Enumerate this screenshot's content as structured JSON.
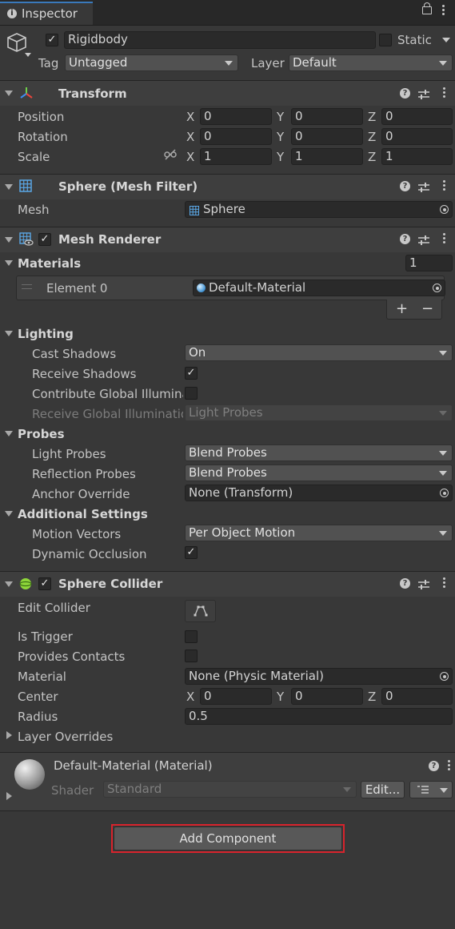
{
  "window": {
    "tab_title": "Inspector"
  },
  "object": {
    "name": "Rigidbody",
    "static_label": "Static",
    "tag_label": "Tag",
    "tag_value": "Untagged",
    "layer_label": "Layer",
    "layer_value": "Default"
  },
  "transform": {
    "title": "Transform",
    "rows": [
      {
        "label": "Position",
        "x": "0",
        "y": "0",
        "z": "0"
      },
      {
        "label": "Rotation",
        "x": "0",
        "y": "0",
        "z": "0"
      },
      {
        "label": "Scale",
        "x": "1",
        "y": "1",
        "z": "1"
      }
    ],
    "axis": {
      "x": "X",
      "y": "Y",
      "z": "Z"
    }
  },
  "mesh_filter": {
    "title": "Sphere (Mesh Filter)",
    "mesh_label": "Mesh",
    "mesh_value": "Sphere"
  },
  "mesh_renderer": {
    "title": "Mesh Renderer",
    "materials_label": "Materials",
    "materials_count": "1",
    "element_label": "Element 0",
    "element_value": "Default-Material",
    "plus": "+",
    "minus": "−",
    "lighting_label": "Lighting",
    "cast_shadows_label": "Cast Shadows",
    "cast_shadows_value": "On",
    "receive_shadows_label": "Receive Shadows",
    "contribute_gi_label": "Contribute Global Illuminat",
    "receive_gi_label": "Receive Global Illuminatio",
    "receive_gi_value": "Light Probes",
    "probes_label": "Probes",
    "light_probes_label": "Light Probes",
    "light_probes_value": "Blend Probes",
    "reflection_probes_label": "Reflection Probes",
    "reflection_probes_value": "Blend Probes",
    "anchor_override_label": "Anchor Override",
    "anchor_override_value": "None (Transform)",
    "additional_label": "Additional Settings",
    "motion_vectors_label": "Motion Vectors",
    "motion_vectors_value": "Per Object Motion",
    "dynamic_occlusion_label": "Dynamic Occlusion"
  },
  "sphere_collider": {
    "title": "Sphere Collider",
    "edit_collider_label": "Edit Collider",
    "is_trigger_label": "Is Trigger",
    "provides_contacts_label": "Provides Contacts",
    "material_label": "Material",
    "material_value": "None (Physic Material)",
    "center_label": "Center",
    "center": {
      "x": "0",
      "y": "0",
      "z": "0"
    },
    "radius_label": "Radius",
    "radius_value": "0.5",
    "layer_overrides_label": "Layer Overrides"
  },
  "material": {
    "title": "Default-Material (Material)",
    "shader_label": "Shader",
    "shader_value": "Standard",
    "edit_button": "Edit..."
  },
  "add_component_label": "Add Component",
  "colors": {
    "highlight_outline": "#d8232c",
    "tab_accent": "#3a79bb",
    "check_fill": "#e6e6e6"
  }
}
